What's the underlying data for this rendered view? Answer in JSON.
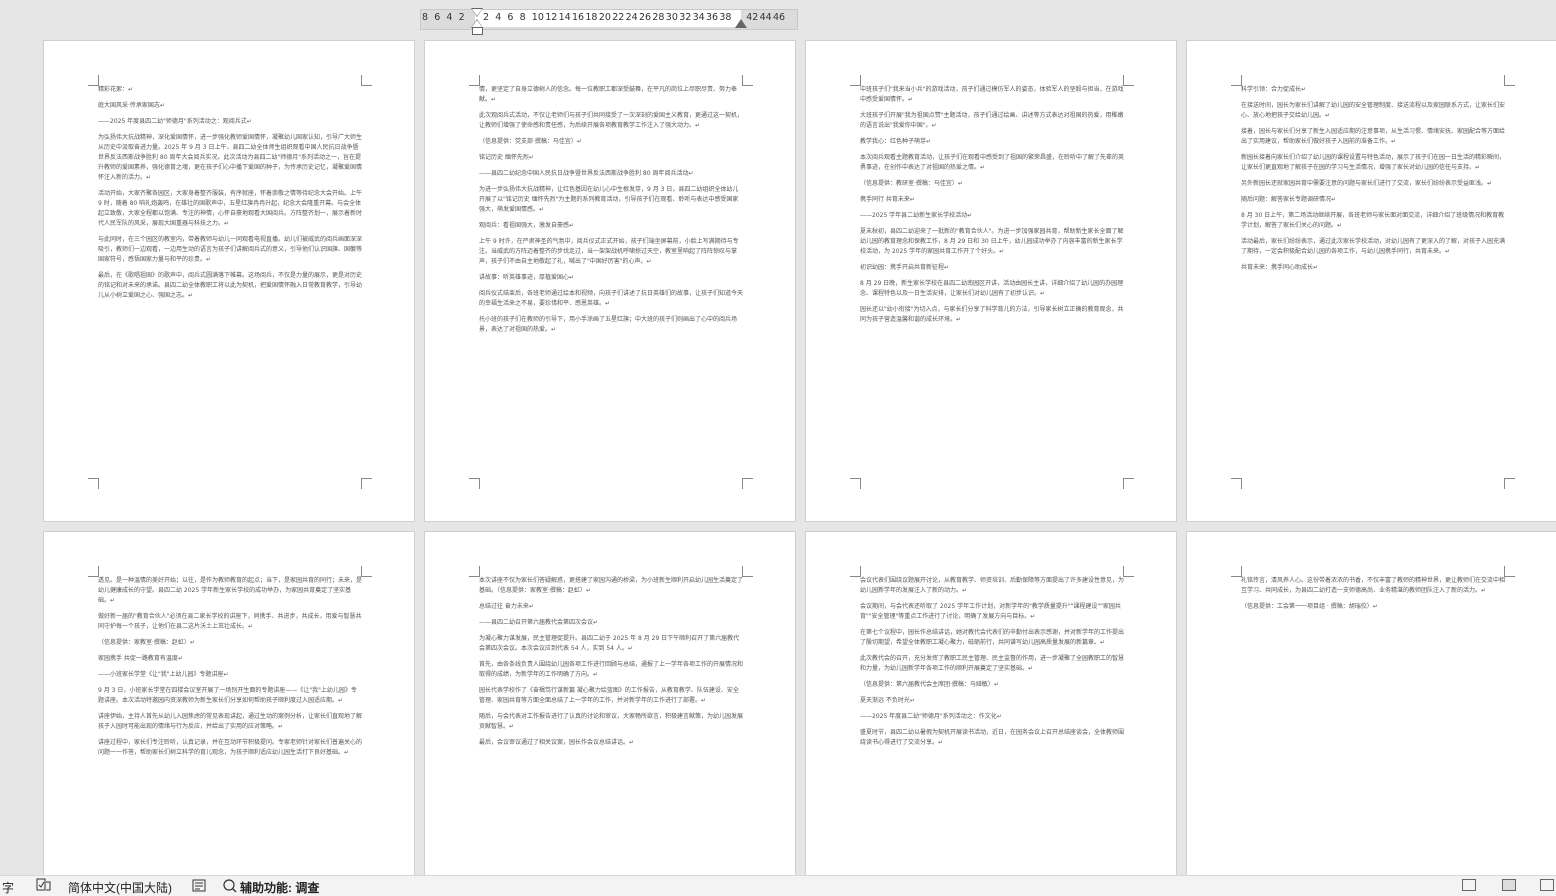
{
  "ruler": {
    "numbers": [
      "8",
      "6",
      "4",
      "2",
      "",
      "2",
      "4",
      "6",
      "8",
      "10",
      "12",
      "14",
      "16",
      "18",
      "20",
      "22",
      "24",
      "26",
      "28",
      "30",
      "32",
      "34",
      "36",
      "38",
      "",
      "42",
      "44",
      "46"
    ]
  },
  "pages": [
    {
      "paragraphs": [
        "精彩花絮：↵",
        "庭大国风采·传承家国志↵",
        "——2025 年度县四二幼\"师德月\"系列活动之：观阅兵式↵",
        "为弘扬伟大抗战精神，深化爱国情怀，进一步强化教师爱国情怀，凝聚幼儿国家认知，引导广大师生从历史中汲取奋进力量。2025 年 9 月 3 日上午，县四二幼全体师生组织观看中国人民抗日战争暨世界反法西斯战争胜利 80 周年大会阅兵实况。此次活动为县四二幼\"师德月\"系列活动之一，旨在提升教师的爱国素养，强化德育之魂，更在孩子们心中播下爱国的种子，为传承历史记忆，凝聚爱国情怀注入新的活力。↵",
        "活动开始，大家齐聚各园区，大家身着整齐服装，有序就座，怀着崇敬之情等待纪念大会开始。上午 9 时，随着 80 响礼炮轰鸣，在雄壮的国歌声中，五星红旗冉冉升起，纪念大会隆重开幕。与会全体起立致敬，大家全程都以饱满、专注的神情，心怀自豪地观看大国阅兵。方阵整齐划一，展示着新时代人民军队的风采，展现大国重器与科技之力。↵",
        "与此同时，在三个园区的教室内，带着教师与幼儿一同观看电视直播。幼儿们被威武的阅兵画面深深吸引，教师们一边观看，一边用生动的语言为孩子们讲解阅兵式的意义，引导他们认识国旗、国徽等国家符号，感悟国家力量与和平的珍贵。↵",
        "最后，在《歌唱祖国》的歌声中，阅兵式圆满落下帷幕。这场阅兵，不仅是力量的展示，更是对历史的铭记和对未来的承诺。县四二幼全体教职工将以此为契机，把爱国情怀融入日常教育教学，引导幼儿从小树立爱国之心、强国之志。↵"
      ]
    },
    {
      "paragraphs": [
        "情，更坚定了自身立德树人的信念。每一位教职工都深受鼓舞，在平凡的岗位上尽职尽责、努力奉献。↵",
        "此次观阅兵式活动，不仅让老师们与孩子们共同接受了一次深刻的爱国主义教育，更通过这一契机，让教师们增强了使命感和责任感，为后续开展各项教育教学工作注入了强大动力。↵",
        "（信息提供：党支部·撰稿：马佳宜）↵",
        "铭记历史 缅怀先烈↵",
        "——县四二幼纪念中国人民抗日战争暨世界反法西斯战争胜利 80 周年阅兵活动↵",
        "为进一步弘扬伟大抗战精神，让红色基因在幼儿心中生根发芽，9 月 3 日，县四二幼组织全体幼儿开展了以\"铭记历史 缅怀先烈\"为主题的系列教育活动，引导孩子们在观看、聆听与表达中感受国家强大，萌发爱国情感。↵",
        "观阅兵：看祖国强大，激发自豪感↵",
        "上午 9 时许，在严肃神圣的气氛中，阅兵仪式正式开始，孩子们端坐屏幕前，小脸上写满期待与专注。当威武的方阵迈着整齐的步伐走过，当一架架战机呼啸掠过天空，教室里响起了阵阵惊叹与掌声，孩子们不由自主地敬起了礼，喊出了\"中国好厉害\"的心声。↵",
        "讲故事：听英雄事迹，厚植爱国心↵",
        "阅兵仪式结束后，各班老师通过绘本和视频，向孩子们讲述了抗日英雄们的故事，让孩子们知道今天的幸福生活来之不易，要珍惜和平、感恩英雄。↵",
        "托小班的孩子们在教师的引导下，用小手涂画了五星红旗；中大班的孩子们则画出了心中的阅兵场景，表达了对祖国的热爱。↵"
      ]
    },
    {
      "paragraphs": [
        "中班孩子们\"我来当小兵\"的游戏活动，孩子们通过模仿军人的姿态，体验军人的坚毅与担当，在游戏中感受爱国情怀。↵",
        "大班孩子们开展\"我为祖国点赞\"主题活动，孩子们通过绘画、讲述等方式表达对祖国的热爱，用稚嫩的语言说出\"我爱你中国\"。↵",
        "教学我心：红色种子萌芽↵",
        "本次阅兵观看主题教育活动，让孩子们在观看中感受到了祖国的繁荣昌盛，在聆听中了解了先辈的英勇事迹，在创作中表达了对祖国的热爱之情。↵",
        "（信息提供：教研室·撰稿：马佳宜）↵",
        "携手同行 共育未来↵",
        "——2025 学年县二幼新生家长学校活动↵",
        "夏末秋初，县四二幼迎来了一批新的\"教育合伙人\"。为进一步加强家园共育，帮助新生家长全面了解幼儿园的教育理念和保教工作，8 月 29 日和 30 日上午，幼儿园成功举办了内容丰富的新生家长学校活动，为 2025 学年的家园共育工作开了个好头。↵",
        "初识幼园：携手开启共育新征程↵",
        "8 月 29 日晚，新生家长学校在县四二幼南园区开讲，活动由园长主讲，详细介绍了幼儿园的办园理念、课程特色以及一日生活安排，让家长们对幼儿园有了初步认识。↵",
        "园长还以\"幼小衔接\"为切入点，与家长们分享了科学育儿的方法，引导家长树立正确的教育观念，共同为孩子营造温馨和谐的成长环境。↵"
      ]
    },
    {
      "paragraphs": [
        "科学引领：合力促成长↵",
        "在接送时间，园长为家长们讲解了幼儿园的安全管理制度、接送流程以及家园联系方式，让家长们安心、放心地把孩子交给幼儿园。↵",
        "接着，园长与家长们分享了新生入园适应期的注意事项，从生活习惯、情绪安抚、家园配合等方面给出了实用建议，帮助家长们做好孩子入园前的准备工作。↵",
        "新园长接着向家长们介绍了幼儿园的课程设置与特色活动，展示了孩子们在园一日生活的精彩瞬间，让家长们更直观地了解孩子在园的学习与生活情况，增强了家长对幼儿园的信任与支持。↵",
        "另外新园长还就家园共育中需要注意的问题与家长们进行了交流，家长们纷纷表示受益匪浅。↵",
        "随后问题：解答家长专题调研情况↵",
        "8 月 30 日上午，第二场活动继续开展，各班老师与家长面对面交流，详细介绍了班级情况和教育教学计划，解答了家长们关心的问题。↵",
        "活动最后，家长们纷纷表示，通过此次家长学校活动，对幼儿园有了更深入的了解，对孩子入园充满了期待，一定会积极配合幼儿园的各项工作，与幼儿园携手同行，共育未来。↵",
        "共育未来：携手同心助成长↵"
      ]
    },
    {
      "paragraphs": [
        "透见。是一种温情的美好开始；以往，是作为教师教育的起点；当下，是家园共育的同行；未来，是幼儿健康成长的守望。县四二幼 2025 学年新生家长学校的成功举办，为家园共育奠定了坚实基础。↵",
        "做好新一届的\"教育合伙人\"必须在县二家长学校的讲座下，同携手、共进步，共成长，用爱与智慧共同守护每一个孩子，让他们在县二这片沃土上茁壮成长。↵",
        "（信息提供：家教室·撰稿：赵虹）↵",
        "家园携手 共促一路教育有温度↵",
        "——小班家长学堂《让\"我\"上幼儿园》专题讲座↵",
        "9 月 3 日，小班家长学堂在四楼会议室开展了一场别开生面的专题讲座——《让\"我\"上幼儿园》专题讲座。本次活动特邀园内资深教师为新生家长们分享如何帮助孩子顺利度过入园适应期。↵",
        "讲座伊始，主持人首先从幼儿入园焦虑的常见表现讲起，通过生动的案例分析，让家长们直观地了解孩子入园时可能出现的情绪与行为反应，并给出了实用的应对策略。↵",
        "讲座过程中，家长们专注聆听，认真记录，并在互动环节积极提问。专家老师针对家长们普遍关心的问题一一作答，帮助家长们树立科学的育儿观念，为孩子顺利适应幼儿园生活打下良好基础。↵"
      ]
    },
    {
      "paragraphs": [
        "本次讲座不仅为家长们答疑解惑，更搭建了家园沟通的桥梁，为小班新生顺利开启幼儿园生活奠定了基础。（信息提供：家教室·撰稿：赵虹）↵",
        "总结过往 奋力未来↵",
        "——县四二幼召开第六届教代会第四次会议↵",
        "为凝心聚力谋发展，民主管理促提升。县四二幼于 2025 年 8 月 29 日下午顺利召开了第六届教代会第四次会议。本次会议应到代表 54 人，实到 54 人。↵",
        "首先，由各条线负责人围绕幼儿园各项工作进行回顾与总结，通报了上一学年各项工作的开展情况和取得的成绩，为新学年的工作明确了方向。↵",
        "园长代表学校作了《奋楫笃行谋新篇 凝心聚力绘蓝图》的工作报告，从教育教学、队伍建设、安全管理、家园共育等方面全面总结了上一学年的工作，并对新学年的工作进行了部署。↵",
        "随后，与会代表对工作报告进行了认真的讨论和审议，大家畅所欲言，积极建言献策，为幼儿园发展贡献智慧。↵",
        "最后，会议审议通过了相关议案，园长作会议总结讲话。↵"
      ]
    },
    {
      "paragraphs": [
        "会议代表们围绕议题展开讨论，从教育教学、师资培训、后勤保障等方面提出了许多建设性意见，为幼儿园新学年的发展注入了新的动力。↵",
        "会议期间，与会代表还听取了 2025 学年工作计划，对新学年的\"教学质量提升\"\"课程建设\"\"家园共育\"\"安全管理\"等重点工作进行了讨论，明确了发展方向与目标。↵",
        "在第七个议程中，园长作总结讲话，她对教代会代表们的辛勤付出表示感谢，并对新学年的工作提出了殷切期望，希望全体教职工凝心聚力，砥砺前行，共同谱写幼儿园高质量发展的新篇章。↵",
        "此次教代会的召开，充分发挥了教职工民主管理、民主监督的作用，进一步凝聚了全园教职工的智慧和力量，为幼儿园新学年各项工作的顺利开展奠定了坚实基础。↵",
        "（信息提供：第六届教代会主席团·撰稿：马娅敏）↵",
        "夏天渐远 不负时光↵",
        "——2025 年度县二幼\"师德月\"系列活动之：作文化↵",
        "盛夏时节，县四二幼以暑假为契机开展读书活动，近日，在园务会议上召开总结座谈会，全体教师围绕读书心得进行了交流分享。↵"
      ]
    },
    {
      "paragraphs": [
        "礼铭传言，清风养人心。这份带着浓浓的书香，不仅丰富了教师的精神世界，更让教师们在交流中相互学习、共同成长，为县四二幼打造一支师德高尚、业务精湛的教师团队注入了新的活力。↵",
        "（信息提供：工会第一一项目组 · 撰稿：胡瑞佼）↵"
      ]
    }
  ],
  "statusbar": {
    "word_count": "字",
    "language": "简体中文(中国大陆)",
    "accessibility": "辅助功能: 调查"
  }
}
